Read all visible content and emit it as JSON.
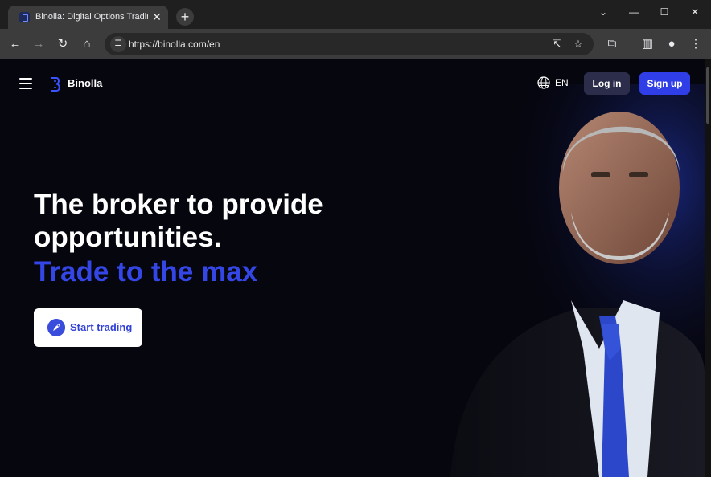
{
  "browser": {
    "tab_title": "Binolla: Digital Options Trading",
    "url": "https://binolla.com/en"
  },
  "site": {
    "brand": "Binolla",
    "language": "EN",
    "login_label": "Log in",
    "signup_label": "Sign up"
  },
  "hero": {
    "headline_line1": "The broker to provide",
    "headline_line2": "opportunities.",
    "headline_accent": "Trade to the max",
    "cta_label": "Start trading"
  },
  "colors": {
    "accent": "#3447e6",
    "page_background": "#06060f",
    "signup_button": "#2f3ee6",
    "login_button": "#2b2d4a"
  }
}
